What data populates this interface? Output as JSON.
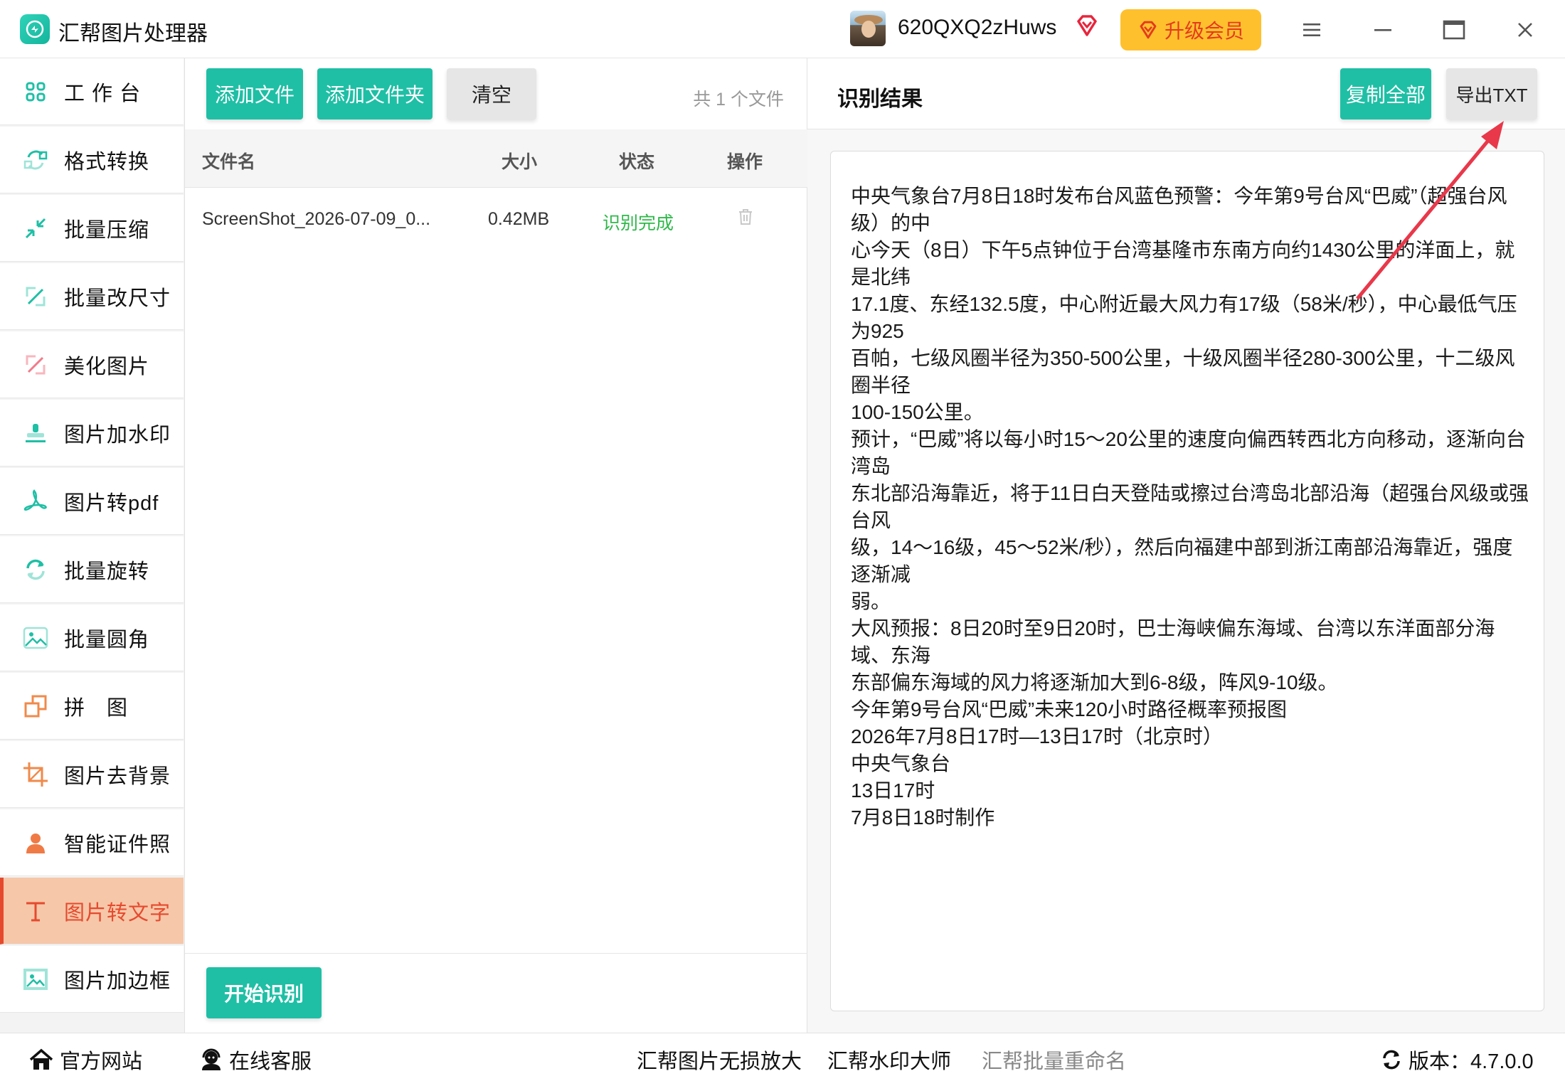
{
  "app": {
    "title": "汇帮图片处理器",
    "username": "620QXQ2zHuws",
    "upgrade_label": "升级会员",
    "accent": "#1fbfa5",
    "active_color": "#e64a2e"
  },
  "window_controls": [
    "menu-icon",
    "minimize-icon",
    "maximize-icon",
    "close-icon"
  ],
  "sidebar": {
    "items": [
      {
        "label": "工 作 台",
        "icon": "grid-icon"
      },
      {
        "label": "格式转换",
        "icon": "convert-icon"
      },
      {
        "label": "批量压缩",
        "icon": "compress-icon"
      },
      {
        "label": "批量改尺寸",
        "icon": "resize-icon"
      },
      {
        "label": "美化图片",
        "icon": "beautify-icon"
      },
      {
        "label": "图片加水印",
        "icon": "stamp-icon"
      },
      {
        "label": "图片转pdf",
        "icon": "pdf-icon"
      },
      {
        "label": "批量旋转",
        "icon": "rotate-icon"
      },
      {
        "label": "批量圆角",
        "icon": "image-icon"
      },
      {
        "label": "拼　图",
        "icon": "puzzle-icon"
      },
      {
        "label": "图片去背景",
        "icon": "crop-icon"
      },
      {
        "label": "智能证件照",
        "icon": "person-icon"
      },
      {
        "label": "图片转文字",
        "icon": "text-icon",
        "active": true
      },
      {
        "label": "图片加边框",
        "icon": "frame-icon"
      }
    ]
  },
  "file_panel": {
    "add_file": "添加文件",
    "add_folder": "添加文件夹",
    "clear": "清空",
    "file_count": "共 1 个文件",
    "columns": {
      "name": "文件名",
      "size": "大小",
      "status": "状态",
      "action": "操作"
    },
    "rows": [
      {
        "name": "ScreenShot_2026-07-09_0...",
        "size": "0.42MB",
        "status": "识别完成"
      }
    ],
    "start_label": "开始识别"
  },
  "result_panel": {
    "title": "识别结果",
    "copy_all": "复制全部",
    "export_txt": "导出TXT",
    "lines": [
      "中央气象台7月8日18时发布台风蓝色预警：今年第9号台风“巴威”（超强台风级）的中",
      "心今天（8日）下午5点钟位于台湾基隆市东南方向约1430公里的洋面上，就是北纬",
      "17.1度、东经132.5度，中心附近最大风力有17级（58米/秒），中心最低气压为925",
      "百帕，七级风圈半径为350-500公里，十级风圈半径280-300公里，十二级风圈半径",
      "100-150公里。",
      "预计，“巴威”将以每小时15～20公里的速度向偏西转西北方向移动，逐渐向台湾岛",
      "东北部沿海靠近，将于11日白天登陆或擦过台湾岛北部沿海（超强台风级或强台风",
      "级，14～16级，45～52米/秒），然后向福建中部到浙江南部沿海靠近，强度逐渐减",
      "弱。",
      "大风预报：8日20时至9日20时，巴士海峡偏东海域、台湾以东洋面部分海域、东海",
      "东部偏东海域的风力将逐渐加大到6-8级，阵风9-10级。",
      "今年第9号台风“巴威”未来120小时路径概率预报图",
      "2026年7月8日17时—13日17时（北京时）",
      "中央气象台",
      "13日17时",
      "7月8日18时制作"
    ]
  },
  "statusbar": {
    "website": "官方网站",
    "support": "在线客服",
    "link1": "汇帮图片无损放大",
    "link2": "汇帮水印大师",
    "link3": "汇帮批量重命名",
    "version": "版本：4.7.0.0"
  }
}
